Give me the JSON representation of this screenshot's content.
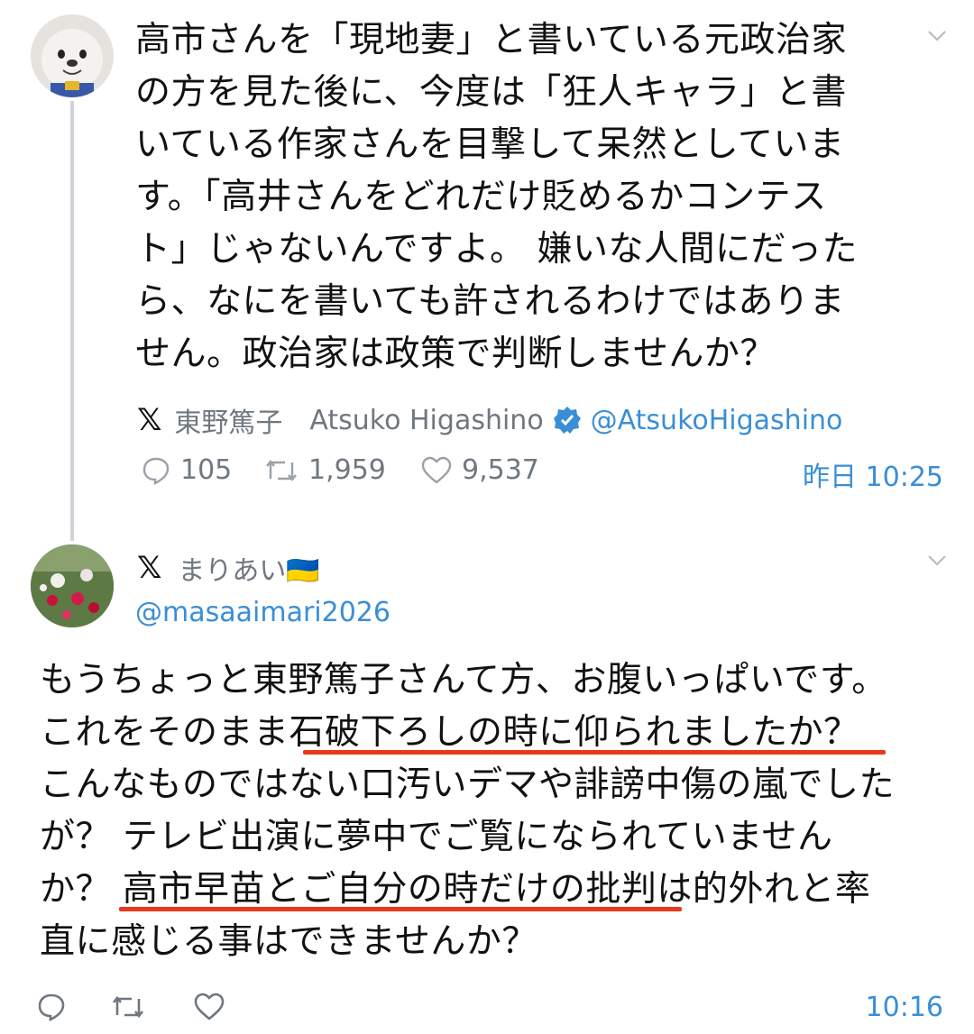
{
  "tweet1": {
    "lines": [
      "高市さんを「現地妻」と書いている元政治家",
      "の方を見た後に、今度は「狂人キャラ」と書",
      "いている作家さんを目撃して呆然としていま",
      "す。「高井さんをどれだけ貶めるかコンテス",
      "ト」じゃないんですよ。 嫌いな人間にだった",
      "ら、なにを書いても許されるわけではありま",
      "せん。政治家は政策で判断しませんか？"
    ],
    "source_logo": "𝕏",
    "author_name": "東野篤子",
    "author_romaji": "Atsuko Higashino",
    "author_handle": "@AtsukoHigashino",
    "replies": "105",
    "retweets": "1,959",
    "likes": "9,537",
    "timestamp": "昨日 10:25"
  },
  "tweet2": {
    "source_logo": "𝕏",
    "author_name": "まりあい🇺🇦",
    "author_handle": "@masaaimari2026",
    "lines": [
      "もうちょっと東野篤子さんて方、お腹いっぱいです。",
      "これをそのまま石破下ろしの時に仰られましたか？",
      "こんなものではない口汚いデマや誹謗中傷の嵐でした",
      "が？ テレビ出演に夢中でご覧になられていません",
      "か？ 高市早苗とご自分の時だけの批判は的外れと率",
      "直に感じる事はできませんか？"
    ],
    "timestamp": "10:16"
  },
  "colors": {
    "accent": "#3a8ed6",
    "underline": "#e8391f",
    "muted": "#6f7780"
  },
  "icons": [
    "reply-icon",
    "retweet-icon",
    "like-icon",
    "verified-badge-icon",
    "chevron-down-icon"
  ]
}
